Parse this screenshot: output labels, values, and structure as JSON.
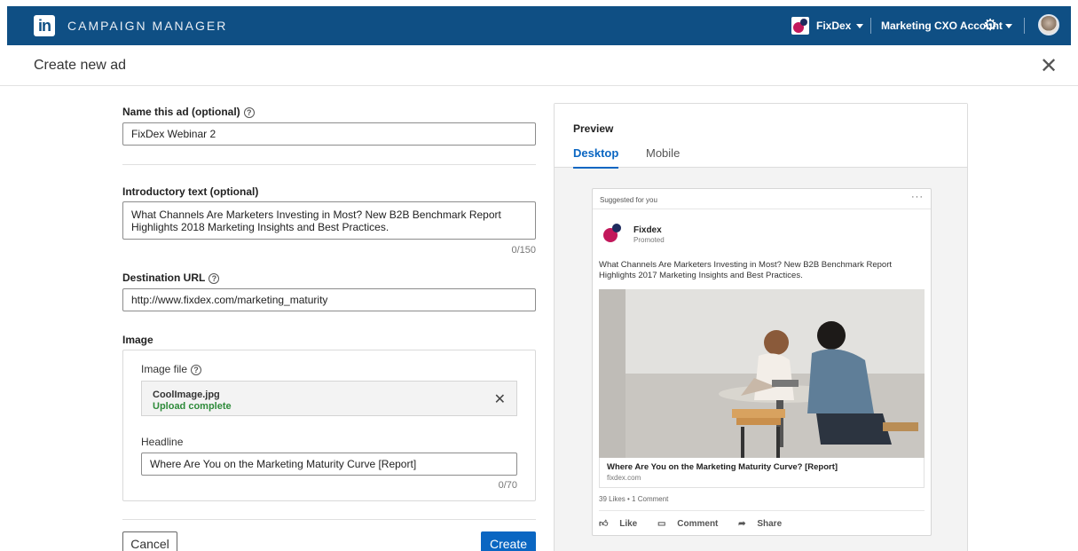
{
  "topbar": {
    "logo_text": "in",
    "app_name": "CAMPAIGN MANAGER",
    "account_name": "FixDex",
    "marketing_account": "Marketing CXO Account"
  },
  "header": {
    "title": "Create new ad",
    "close_glyph": "✕"
  },
  "form": {
    "name_label": "Name this ad (optional)",
    "name_value": "FixDex Webinar 2",
    "intro_label": "Introductory text (optional)",
    "intro_value": "What Channels Are Marketers Investing in Most? New B2B Benchmark Report Highlights 2018 Marketing Insights and Best Practices.",
    "intro_counter": "0/150",
    "url_label": "Destination URL",
    "url_value": "http://www.fixdex.com/marketing_maturity",
    "image_section_label": "Image",
    "image_file_label": "Image file",
    "file_name": "CoolImage.jpg",
    "file_status": "Upload complete",
    "headline_label": "Headline",
    "headline_value": "Where Are You on the Marketing Maturity Curve [Report]",
    "headline_counter": "0/70",
    "help_glyph": "?"
  },
  "buttons": {
    "cancel": "Cancel",
    "create": "Create"
  },
  "preview": {
    "title": "Preview",
    "tabs": [
      "Desktop",
      "Mobile"
    ],
    "card": {
      "suggested": "Suggested for you",
      "menu": "···",
      "company": "Fixdex",
      "promoted": "Promoted",
      "text": "What Channels Are Marketers Investing in Most? New B2B Benchmark Report Highlights 2017 Marketing Insights and Best Practices.",
      "headline": "Where Are You on the Marketing Maturity Curve? [Report]",
      "domain": "fixdex.com",
      "engagement": "39 Likes • 1 Comment",
      "actions": [
        "Like",
        "Comment",
        "Share"
      ]
    }
  },
  "colors": {
    "topbar": "#0f4f84",
    "accent": "#0a66c2",
    "success": "#2e8b3a",
    "brand_magenta": "#c2185b",
    "brand_navy": "#1f2b5e"
  }
}
